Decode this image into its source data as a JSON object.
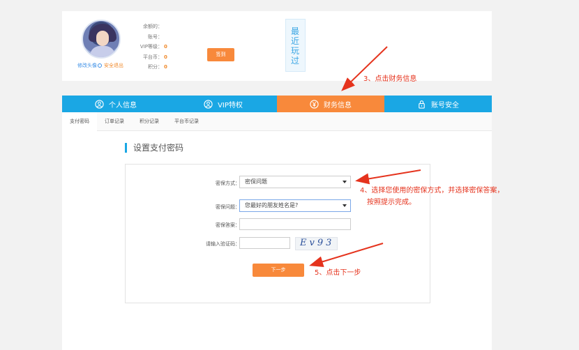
{
  "profile": {
    "edit_avatar": "修改头像",
    "logout": "安全退出",
    "fields": [
      {
        "label": "余额的：",
        "value": "",
        "style": "plain"
      },
      {
        "label": "账号：",
        "value": "",
        "style": "plain"
      },
      {
        "label": "VIP等级：",
        "value": "0",
        "style": "hl"
      },
      {
        "label": "平台币：",
        "value": "0",
        "style": "hl"
      },
      {
        "label": "积分：",
        "value": "0",
        "style": "hl"
      }
    ],
    "signin_button": "签到",
    "recent_played": "最近玩过"
  },
  "nav": {
    "tabs": [
      {
        "label": "个人信息",
        "icon": "user-circle-icon"
      },
      {
        "label": "VIP特权",
        "icon": "vip-user-icon"
      },
      {
        "label": "财务信息",
        "icon": "yen-coin-icon",
        "active": true
      },
      {
        "label": "账号安全",
        "icon": "lock-icon"
      }
    ]
  },
  "subtabs": [
    "支付密码",
    "订单记录",
    "积分记录",
    "平台币记录"
  ],
  "section_title": "设置支付密码",
  "form": {
    "method_label": "密保方式：",
    "method_value": "密保问题",
    "question_label": "密保问题：",
    "question_value": "您最好的朋友姓名是?",
    "answer_label": "密保答案：",
    "captcha_label": "请输入验证码：",
    "captcha_text": "Ev93",
    "next_button": "下一步"
  },
  "annotations": {
    "step3": "3、点击财务信息",
    "step4_line1": "4、选择您使用的密保方式，并选择密保答案，",
    "step4_line2": "按照提示完成。",
    "step5": "5、点击下一步"
  },
  "colors": {
    "nav_blue": "#1aa7e4",
    "accent_orange": "#f8893b",
    "annotation_red": "#e5331d"
  }
}
